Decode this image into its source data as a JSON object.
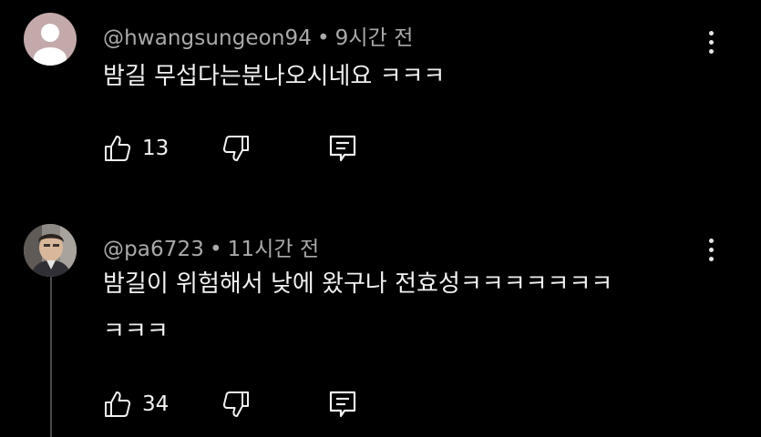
{
  "comments": [
    {
      "handle": "@hwangsungeon94",
      "separator": "•",
      "time": "9시간 전",
      "text": "밤길 무섭다는분나오시네요 ㅋㅋㅋ",
      "likes": "13",
      "avatar": "default-avatar"
    },
    {
      "handle": "@pa6723",
      "separator": "•",
      "time": "11시간 전",
      "text": "밤길이 위험해서 낮에 왔구나 전효성ㅋㅋㅋㅋㅋㅋㅋ\nㅋㅋㅋ",
      "likes": "34",
      "avatar": "photo-avatar"
    }
  ],
  "icons": {
    "like": "thumbs-up-icon",
    "dislike": "thumbs-down-icon",
    "reply": "reply-icon",
    "menu": "more-vert-icon"
  },
  "colors": {
    "background": "#000000",
    "primary_text": "#f1f1f1",
    "secondary_text": "#aaaaaa",
    "default_avatar_bg": "#c3a9a9"
  }
}
